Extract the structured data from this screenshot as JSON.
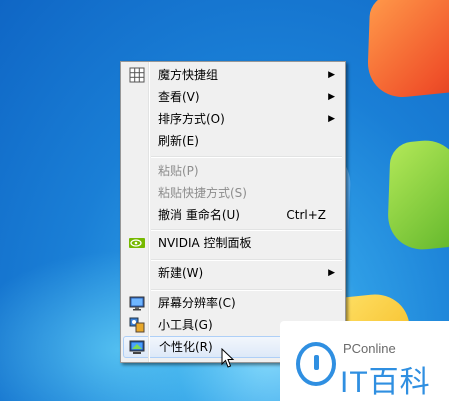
{
  "context_menu": {
    "items": [
      {
        "label": "魔方快捷组",
        "icon": "grid-icon",
        "submenu": true
      },
      {
        "label": "查看(V)",
        "submenu": true
      },
      {
        "label": "排序方式(O)",
        "submenu": true
      },
      {
        "label": "刷新(E)"
      },
      {
        "label": "粘贴(P)",
        "disabled": true
      },
      {
        "label": "粘贴快捷方式(S)",
        "disabled": true
      },
      {
        "label": "撤消 重命名(U)",
        "shortcut": "Ctrl+Z"
      },
      {
        "label": "NVIDIA 控制面板",
        "icon": "nvidia-icon"
      },
      {
        "label": "新建(W)",
        "submenu": true
      },
      {
        "label": "屏幕分辨率(C)",
        "icon": "monitor-icon"
      },
      {
        "label": "小工具(G)",
        "icon": "gadgets-icon"
      },
      {
        "label": "个性化(R)",
        "icon": "personalize-icon",
        "highlighted": true
      }
    ]
  },
  "watermark": {
    "small_text": "PConline",
    "big_text": "IT百科",
    "color": "#2f8fe1"
  },
  "colors": {
    "menu_background": "#f0f0f0",
    "highlight_border": "#aecff7",
    "disabled_text": "#8d8d8d"
  }
}
